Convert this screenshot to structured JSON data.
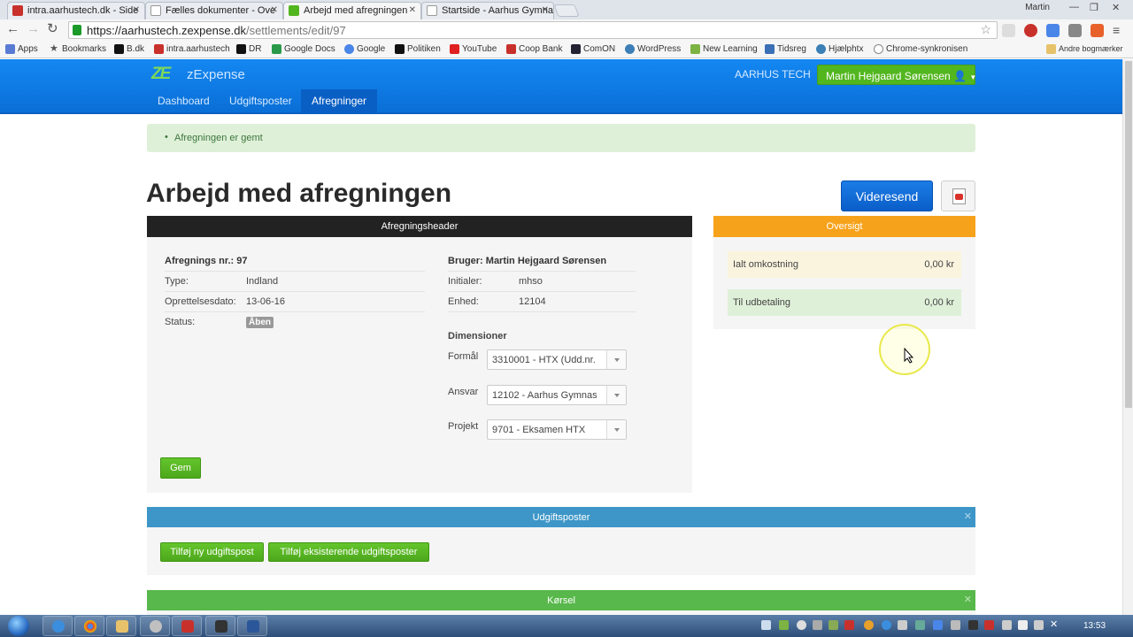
{
  "browser": {
    "tabs": [
      {
        "title": "intra.aarhustech.dk - Side",
        "active": false,
        "color": "#c8312b"
      },
      {
        "title": "Fælles dokumenter - Ove",
        "active": false,
        "color": "#ffffff"
      },
      {
        "title": "Arbejd med afregningen",
        "active": true,
        "color": "#52b61f"
      },
      {
        "title": "Startside - Aarhus Gymna",
        "active": false,
        "color": "#ffffff"
      }
    ],
    "profile_name": "Martin",
    "url_base": "https://aarhustech.zexpense.dk",
    "url_path": "/settlements/edit/97",
    "bookmarks": [
      "Apps",
      "Bookmarks",
      "B.dk",
      "intra.aarhustech",
      "DR",
      "Google Docs",
      "Google",
      "Politiken",
      "YouTube",
      "Coop Bank",
      "ComON",
      "WordPress",
      "New Learning",
      "Tidsreg",
      "Hjælphtx",
      "Chrome-synkronisen",
      "Andre bogmærker"
    ]
  },
  "app": {
    "brand": "zExpense",
    "logo_mark": "ZE",
    "organization": "AARHUS TECH",
    "user_button": "Martin Hejgaard Sørensen",
    "nav": [
      "Dashboard",
      "Udgiftsposter",
      "Afregninger"
    ],
    "nav_active": "Afregninger"
  },
  "alert": "Afregningen er gemt",
  "page_title": "Arbejd med afregningen",
  "forward_button": "Videresend",
  "header_panel": {
    "title": "Afregningsheader",
    "settlement_no_label": "Afregnings nr.: 97",
    "type_label": "Type:",
    "type_value": "Indland",
    "created_label": "Oprettelsesdato:",
    "created_value": "13-06-16",
    "status_label": "Status:",
    "status_value": "Åben",
    "user_label": "Bruger: Martin Hejgaard Sørensen",
    "initials_label": "Initialer:",
    "initials_value": "mhso",
    "unit_label": "Enhed:",
    "unit_value": "12104",
    "dimensions_title": "Dimensioner",
    "purpose_label": "Formål",
    "purpose_value": "3310001 - HTX (Udd.nr.",
    "responsibility_label": "Ansvar",
    "responsibility_value": "12102 - Aarhus Gymnas",
    "project_label": "Projekt",
    "project_value": "9701 - Eksamen HTX",
    "save_button": "Gem"
  },
  "overview": {
    "title": "Oversigt",
    "total_label": "Ialt omkostning",
    "total_value": "0,00 kr",
    "payout_label": "Til udbetaling",
    "payout_value": "0,00 kr"
  },
  "items_panel": {
    "title": "Udgiftsposter",
    "add_new_button": "Tilføj ny udgiftspost",
    "add_existing_button": "Tilføj eksisterende udgiftsposter"
  },
  "driving_panel": {
    "title": "Kørsel"
  },
  "taskbar": {
    "clock": "13:53"
  },
  "colors": {
    "brand_blue": "#0a6fd6",
    "green": "#52b61f",
    "orange": "#f7a21b",
    "dark": "#222222",
    "teal": "#3d96c7"
  }
}
